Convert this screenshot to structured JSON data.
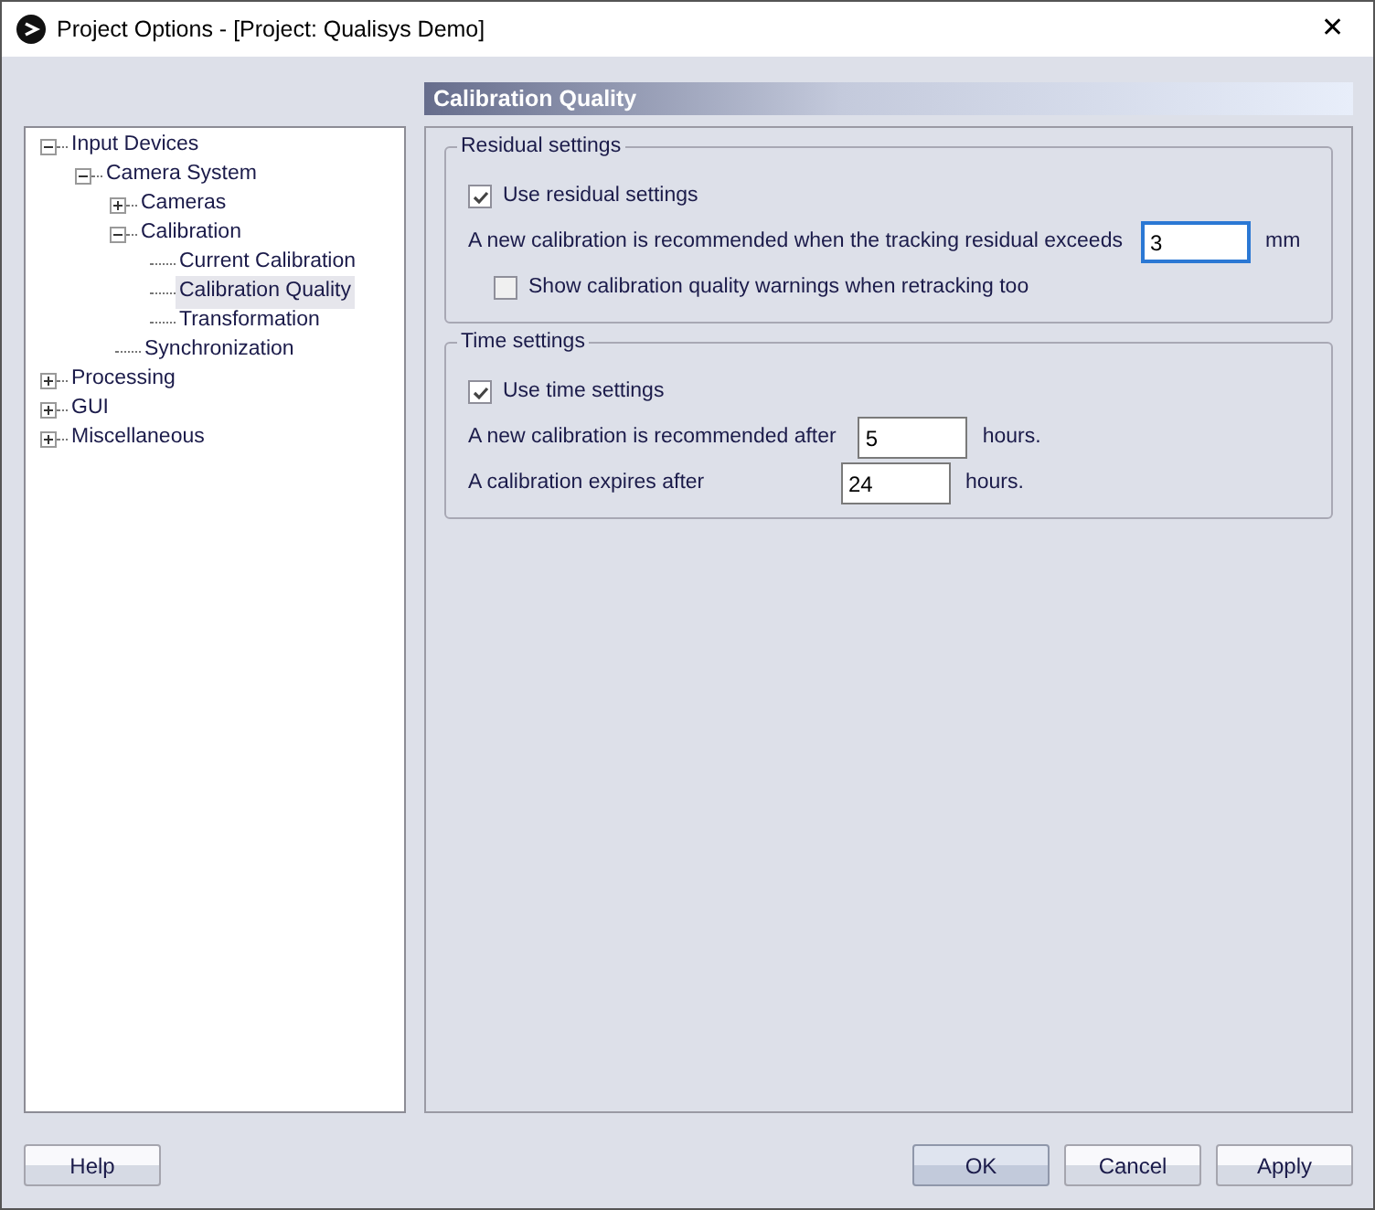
{
  "window": {
    "title": "Project Options - [Project: Qualisys Demo]",
    "close": "✕"
  },
  "tree": [
    {
      "label": "Input Devices",
      "expanded": true,
      "selected": false,
      "children": [
        {
          "label": "Camera System",
          "expanded": true,
          "selected": false,
          "children": [
            {
              "label": "Cameras",
              "expanded": false,
              "selected": false
            },
            {
              "label": "Calibration",
              "expanded": true,
              "selected": false,
              "children": [
                {
                  "label": "Current Calibration",
                  "selected": false
                },
                {
                  "label": "Calibration Quality",
                  "selected": true
                },
                {
                  "label": "Transformation",
                  "selected": false
                }
              ]
            },
            {
              "label": "Synchronization",
              "selected": false
            }
          ]
        }
      ]
    },
    {
      "label": "Processing",
      "expanded": false,
      "selected": false
    },
    {
      "label": "GUI",
      "expanded": false,
      "selected": false
    },
    {
      "label": "Miscellaneous",
      "expanded": false,
      "selected": false
    }
  ],
  "page_title": "Calibration Quality",
  "groups": [
    {
      "title": "Residual settings",
      "rows": [
        {
          "kind": "checkbox",
          "label": "Use residual settings",
          "checked": true
        },
        {
          "kind": "field",
          "label": "A new calibration is recommended when the tracking residual exceeds",
          "value": "3",
          "unit": "mm",
          "focused": true
        },
        {
          "kind": "subcheckbox",
          "label": "Show calibration quality warnings when retracking too",
          "checked": false
        }
      ]
    },
    {
      "title": "Time settings",
      "rows": [
        {
          "kind": "checkbox",
          "label": "Use time settings",
          "checked": true
        },
        {
          "kind": "field",
          "label": "A new calibration is recommended after",
          "value": "5",
          "unit": "hours.",
          "focused": false
        },
        {
          "kind": "field",
          "label": "A calibration expires after",
          "value": "24",
          "unit": "hours.",
          "focused": false
        }
      ]
    }
  ],
  "buttons": [
    {
      "label": "Help",
      "default": false
    },
    {
      "label": "OK",
      "default": true
    },
    {
      "label": "Cancel",
      "default": false
    },
    {
      "label": "Apply",
      "default": false
    }
  ]
}
